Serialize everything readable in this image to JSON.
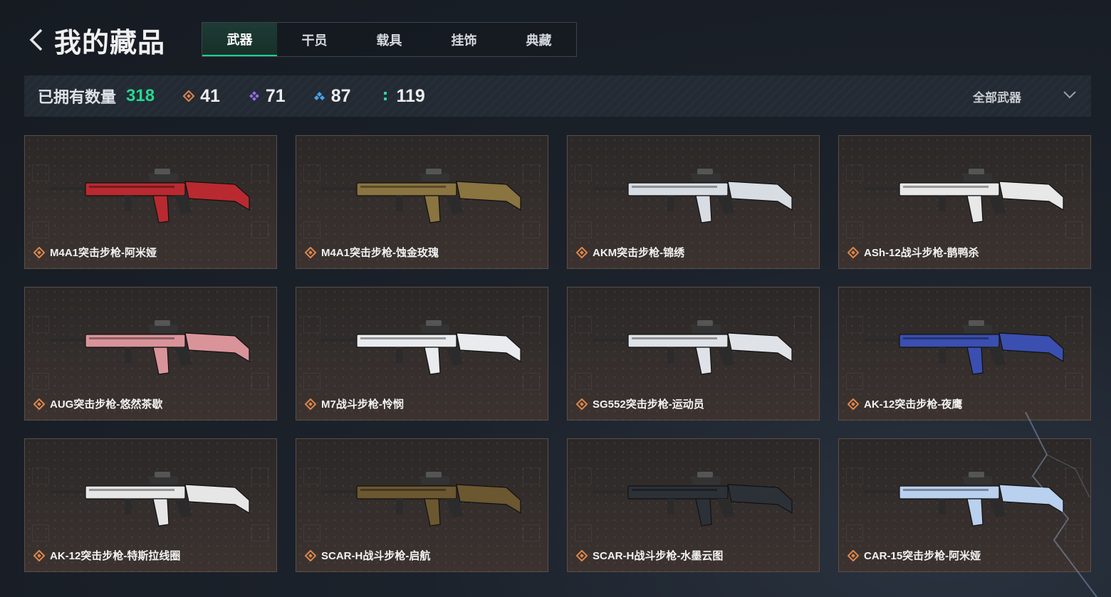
{
  "header": {
    "title": "我的藏品"
  },
  "tabs": [
    {
      "label": "武器",
      "active": true
    },
    {
      "label": "干员",
      "active": false
    },
    {
      "label": "载具",
      "active": false
    },
    {
      "label": "挂饰",
      "active": false
    },
    {
      "label": "典藏",
      "active": false
    }
  ],
  "stats": {
    "owned_label": "已拥有数量",
    "owned_count": "318",
    "rarities": [
      {
        "icon": "orange-diamond-icon",
        "color": "#e0864a",
        "count": "41"
      },
      {
        "icon": "purple-diamond-icon",
        "color": "#9a6cf0",
        "count": "71"
      },
      {
        "icon": "blue-diamond-icon",
        "color": "#4aa3e8",
        "count": "87"
      },
      {
        "icon": "green-dots-icon",
        "color": "#2fd39a",
        "count": "119"
      }
    ]
  },
  "filter": {
    "label": "全部武器",
    "icon": "chevron-down-icon"
  },
  "rarity_badge_color": "#e0864a",
  "items": [
    {
      "name": "M4A1突击步枪-阿米娅",
      "tint": "#b82a30"
    },
    {
      "name": "M4A1突击步枪-蚀金玫瑰",
      "tint": "#8a7440"
    },
    {
      "name": "AKM突击步枪-锦绣",
      "tint": "#d8dde4"
    },
    {
      "name": "ASh-12战斗步枪-鹊鸭杀",
      "tint": "#e8e8e8"
    },
    {
      "name": "AUG突击步枪-悠然茶歇",
      "tint": "#d9949a"
    },
    {
      "name": "M7战斗步枪-怜悯",
      "tint": "#e9ebee"
    },
    {
      "name": "SG552突击步枪-运动员",
      "tint": "#dfe2e6"
    },
    {
      "name": "AK-12突击步枪-夜鹰",
      "tint": "#3a4fb0"
    },
    {
      "name": "AK-12突击步枪-特斯拉线圈",
      "tint": "#e6e6e6"
    },
    {
      "name": "SCAR-H战斗步枪-启航",
      "tint": "#6b5730"
    },
    {
      "name": "SCAR-H战斗步枪-水墨云图",
      "tint": "#2c3138"
    },
    {
      "name": "CAR-15突击步枪-阿米娅",
      "tint": "#b9d0ee"
    }
  ]
}
